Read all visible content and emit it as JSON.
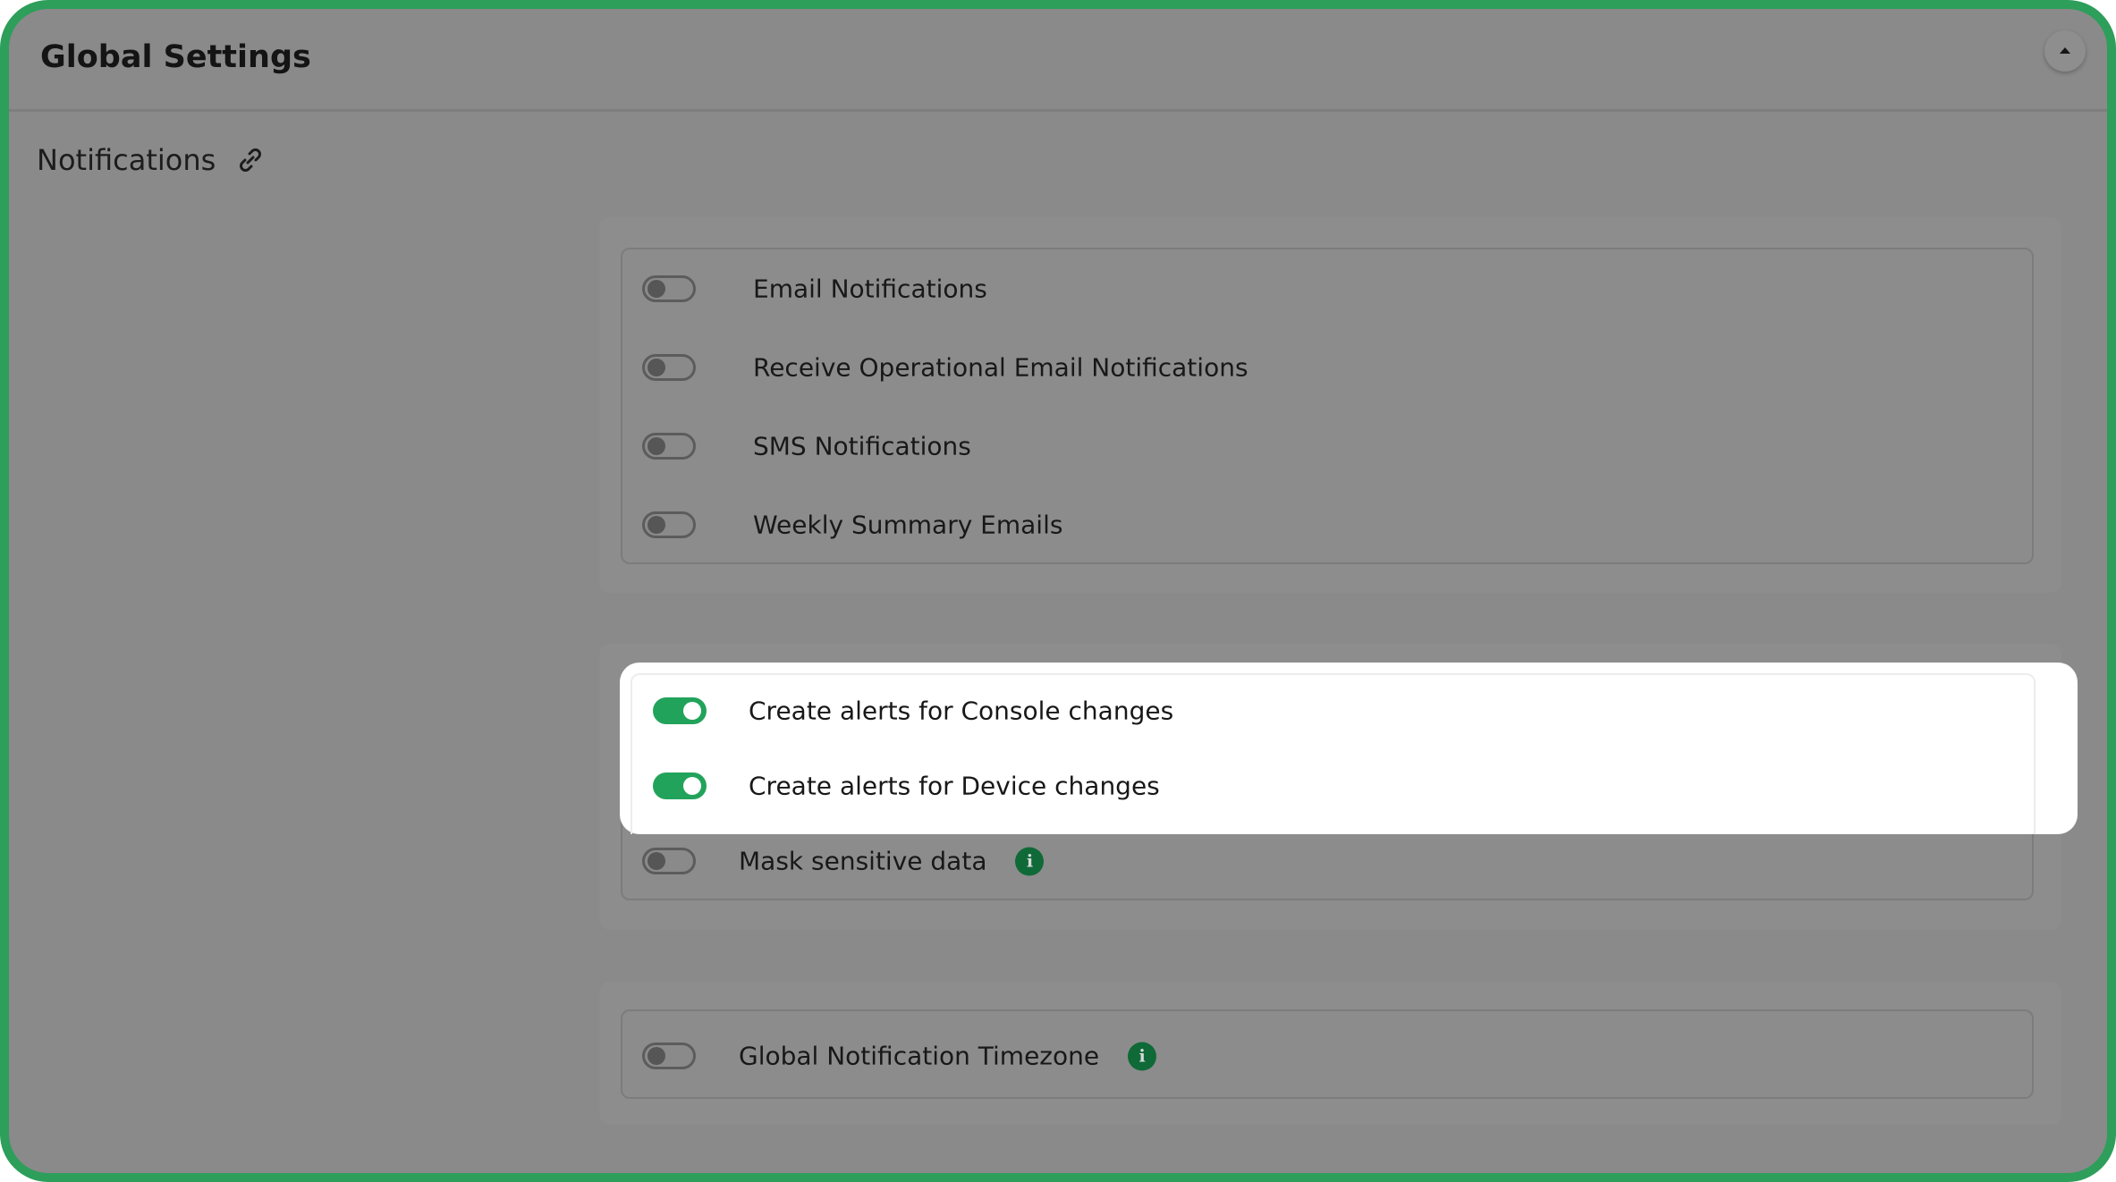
{
  "window": {
    "title": "Global Settings"
  },
  "section": {
    "title": "Notifications",
    "link_icon": "link-icon",
    "collapse_icon": "caret-up-icon"
  },
  "groups": {
    "notifications": [
      {
        "label": "Email Notifications",
        "enabled": false
      },
      {
        "label": "Receive Operational Email Notifications",
        "enabled": false
      },
      {
        "label": "SMS Notifications",
        "enabled": false
      },
      {
        "label": "Weekly Summary Emails",
        "enabled": false
      }
    ],
    "alerts": [
      {
        "label": "Create alerts for Console changes",
        "enabled": true
      },
      {
        "label": "Create alerts for Device changes",
        "enabled": true
      },
      {
        "label": "Mask sensitive data",
        "enabled": false,
        "info": true
      }
    ],
    "timezone": [
      {
        "label": "Global Notification Timezone",
        "enabled": false,
        "info": true
      }
    ]
  },
  "info_icon_glyph": "i",
  "colors": {
    "frame_border": "#2e9e5b",
    "toggle_on": "#22a35b",
    "info_icon": "#0f6a38",
    "overlay": "#8a8a8a",
    "highlight": "#ffffff"
  }
}
